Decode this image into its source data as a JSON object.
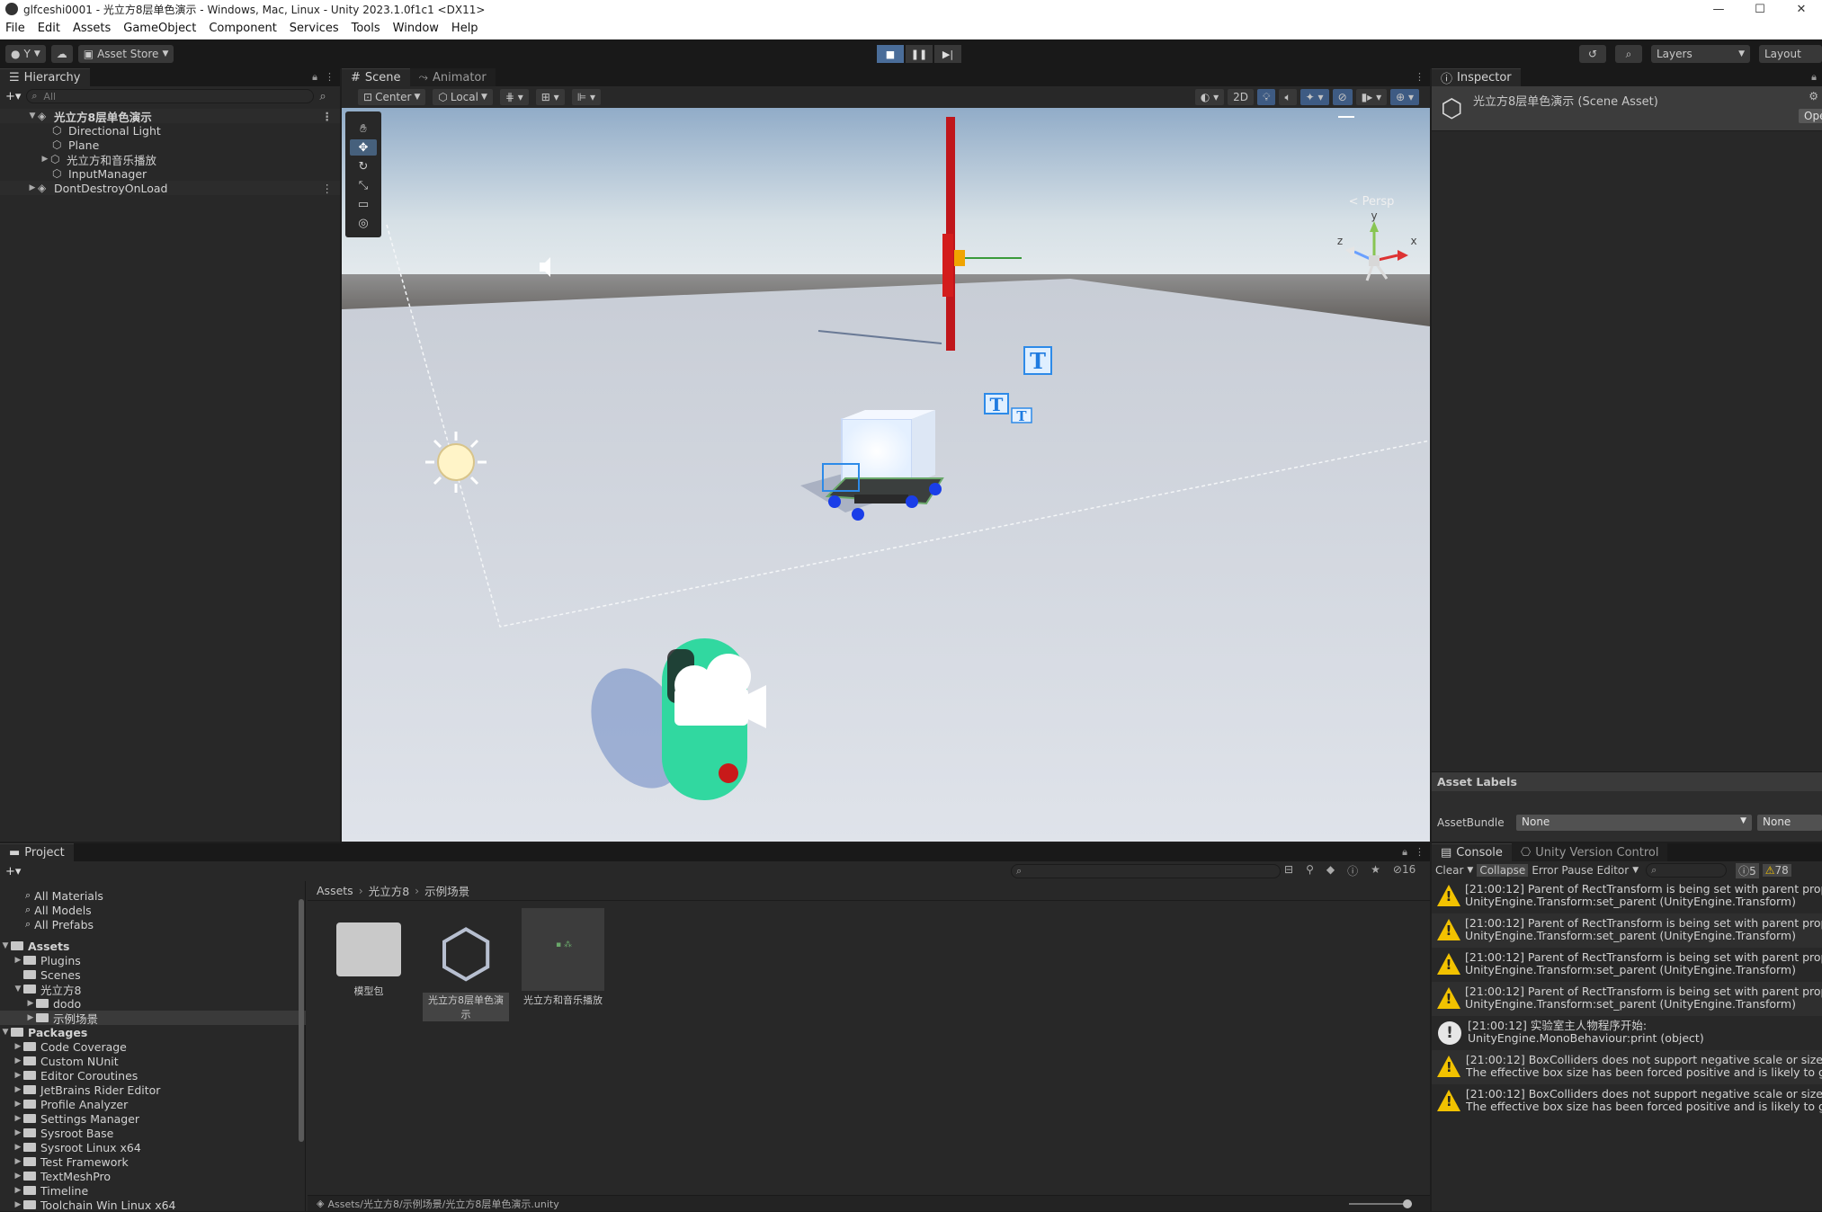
{
  "window": {
    "title": "glfceshi0001 - 光立方8层单色演示 - Windows, Mac, Linux - Unity 2023.1.0f1c1 <DX11>",
    "controls": [
      "—",
      "☐",
      "✕"
    ]
  },
  "menu": [
    "File",
    "Edit",
    "Assets",
    "GameObject",
    "Component",
    "Services",
    "Tools",
    "Window",
    "Help"
  ],
  "toolbar": {
    "account": "Y",
    "asset_store": "Asset Store",
    "layers": "Layers",
    "layout": "Layout"
  },
  "hierarchy": {
    "tab": "Hierarchy",
    "search_placeholder": "All",
    "scene_name": "光立方8层单色演示",
    "items": [
      "Directional Light",
      "Plane",
      "光立方和音乐播放",
      "InputManager"
    ],
    "dont_destroy": "DontDestroyOnLoad"
  },
  "scene_view": {
    "tabs": [
      "Scene",
      "Animator"
    ],
    "pivot": "Center",
    "space": "Local",
    "mode_2d": "2D",
    "persp_label": "< Persp",
    "gizmo_axes": [
      "y",
      "x",
      "z"
    ]
  },
  "inspector": {
    "tab": "Inspector",
    "asset_title": "光立方8层单色演示 (Scene Asset)",
    "open_button": "Open",
    "asset_labels": "Asset Labels",
    "asset_bundle_label": "AssetBundle",
    "asset_bundle_value": "None",
    "asset_bundle_variant": "None"
  },
  "project": {
    "tab": "Project",
    "favorites": [
      "All Materials",
      "All Models",
      "All Prefabs"
    ],
    "assets_root": "Assets",
    "asset_folders": [
      "Plugins",
      "Scenes",
      "光立方8"
    ],
    "subfolders": [
      "dodo",
      "示例场景"
    ],
    "packages_root": "Packages",
    "packages": [
      "Code Coverage",
      "Custom NUnit",
      "Editor Coroutines",
      "JetBrains Rider Editor",
      "Profile Analyzer",
      "Settings Manager",
      "Sysroot Base",
      "Sysroot Linux x64",
      "Test Framework",
      "TextMeshPro",
      "Timeline",
      "Toolchain Win Linux x64"
    ],
    "breadcrumb": [
      "Assets",
      "光立方8",
      "示例场景"
    ],
    "items": [
      "模型包",
      "光立方8层单色演示",
      "光立方和音乐播放"
    ],
    "hidden_count": "16",
    "footer_path": "Assets/光立方8/示例场景/光立方8层单色演示.unity"
  },
  "console": {
    "tabs": [
      "Console",
      "Unity Version Control"
    ],
    "clear": "Clear",
    "collapse": "Collapse",
    "error_pause": "Error Pause",
    "editor": "Editor",
    "info_count": "5",
    "warn_count": "78",
    "entries": [
      {
        "type": "warning",
        "line1": "[21:00:12] Parent of RectTransform is being set with parent property",
        "line2": "UnityEngine.Transform:set_parent (UnityEngine.Transform)"
      },
      {
        "type": "warning",
        "line1": "[21:00:12] Parent of RectTransform is being set with parent property",
        "line2": "UnityEngine.Transform:set_parent (UnityEngine.Transform)"
      },
      {
        "type": "warning",
        "line1": "[21:00:12] Parent of RectTransform is being set with parent property",
        "line2": "UnityEngine.Transform:set_parent (UnityEngine.Transform)"
      },
      {
        "type": "warning",
        "line1": "[21:00:12] Parent of RectTransform is being set with parent property",
        "line2": "UnityEngine.Transform:set_parent (UnityEngine.Transform)"
      },
      {
        "type": "info",
        "line1": "[21:00:12] 实验室主人物程序开始:",
        "line2": "UnityEngine.MonoBehaviour:print (object)"
      },
      {
        "type": "warning",
        "line1": "[21:00:12] BoxColliders does not support negative scale or size.",
        "line2": "The effective box size has been forced positive and is likely to give"
      },
      {
        "type": "warning",
        "line1": "[21:00:12] BoxColliders does not support negative scale or size.",
        "line2": "The effective box size has been forced positive and is likely to give"
      }
    ]
  }
}
